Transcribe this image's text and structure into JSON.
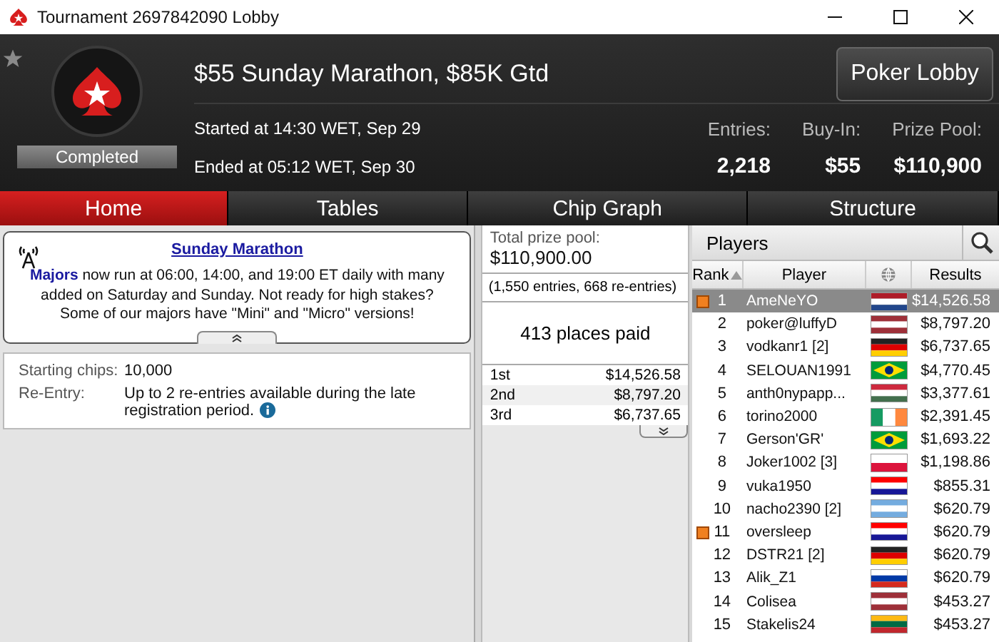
{
  "window": {
    "title": "Tournament 2697842090 Lobby"
  },
  "header": {
    "title": "$55 Sunday Marathon, $85K Gtd",
    "status": "Completed",
    "started": "Started at 14:30 WET, Sep 29",
    "ended": "Ended at 05:12 WET, Sep 30",
    "lobby_button": "Poker Lobby",
    "stats": [
      {
        "label": "Entries:",
        "value": "2,218"
      },
      {
        "label": "Buy-In:",
        "value": "$55"
      },
      {
        "label": "Prize Pool:",
        "value": "$110,900"
      }
    ]
  },
  "tabs": [
    {
      "label": "Home",
      "selected": true
    },
    {
      "label": "Tables",
      "selected": false
    },
    {
      "label": "Chip Graph",
      "selected": false
    },
    {
      "label": "Structure",
      "selected": false
    }
  ],
  "news": {
    "title": "Sunday Marathon",
    "text": "**Majors** now run at 06:00, 14:00, and 19:00 ET daily with many added on Saturday and Sunday. Not ready for high stakes? Some of our majors have \"Mini\" and \"Micro\" versions!"
  },
  "details": [
    {
      "label": "Starting chips:",
      "value": "10,000",
      "info": false
    },
    {
      "label": "Re-Entry:",
      "value": "Up to 2 re-entries available during the late registration period.",
      "info": true
    }
  ],
  "prizes": {
    "label": "Total prize pool:",
    "total": "$110,900.00",
    "entries_note": "(1,550 entries, 668 re-entries)",
    "places": "413 places paid",
    "rows": [
      {
        "place": "1st",
        "amount": "$14,526.58"
      },
      {
        "place": "2nd",
        "amount": "$8,797.20"
      },
      {
        "place": "3rd",
        "amount": "$6,737.65"
      }
    ]
  },
  "players": {
    "title": "Players",
    "columns": [
      "Rank",
      "Player",
      "Results"
    ],
    "rows": [
      {
        "rank": "1",
        "name": "AmeNeYO",
        "kind": "netherlands",
        "result": "$14,526.58",
        "selected": true,
        "marked": true
      },
      {
        "rank": "2",
        "name": "poker@luffyD",
        "kind": "latvia",
        "result": "$8,797.20",
        "selected": false,
        "marked": false
      },
      {
        "rank": "3",
        "name": "vodkanr1 [2]",
        "kind": "germany",
        "result": "$6,737.65",
        "selected": false,
        "marked": false
      },
      {
        "rank": "4",
        "name": "SELOUAN1991",
        "kind": "brazil",
        "result": "$4,770.45",
        "selected": false,
        "marked": false
      },
      {
        "rank": "5",
        "name": "anth0nypapp...",
        "kind": "hungary",
        "result": "$3,377.61",
        "selected": false,
        "marked": false
      },
      {
        "rank": "6",
        "name": "torino2000",
        "kind": "ireland",
        "result": "$2,391.45",
        "selected": false,
        "marked": false
      },
      {
        "rank": "7",
        "name": "Gerson'GR'",
        "kind": "brazil",
        "result": "$1,693.22",
        "selected": false,
        "marked": false
      },
      {
        "rank": "8",
        "name": "Joker1002 [3]",
        "kind": "poland",
        "result": "$1,198.86",
        "selected": false,
        "marked": false
      },
      {
        "rank": "9",
        "name": "vuka1950",
        "kind": "croatia",
        "result": "$855.31",
        "selected": false,
        "marked": false
      },
      {
        "rank": "10",
        "name": "nacho2390 [2]",
        "kind": "argentina",
        "result": "$620.79",
        "selected": false,
        "marked": false
      },
      {
        "rank": "11",
        "name": "oversleep",
        "kind": "croatia",
        "result": "$620.79",
        "selected": false,
        "marked": true
      },
      {
        "rank": "12",
        "name": "DSTR21 [2]",
        "kind": "germany",
        "result": "$620.79",
        "selected": false,
        "marked": false
      },
      {
        "rank": "13",
        "name": "Alik_Z1",
        "kind": "russia",
        "result": "$620.79",
        "selected": false,
        "marked": false
      },
      {
        "rank": "14",
        "name": "Colisea",
        "kind": "latvia",
        "result": "$453.27",
        "selected": false,
        "marked": false
      },
      {
        "rank": "15",
        "name": "Stakelis24",
        "kind": "lithuania",
        "result": "$453.27",
        "selected": false,
        "marked": false
      }
    ]
  }
}
